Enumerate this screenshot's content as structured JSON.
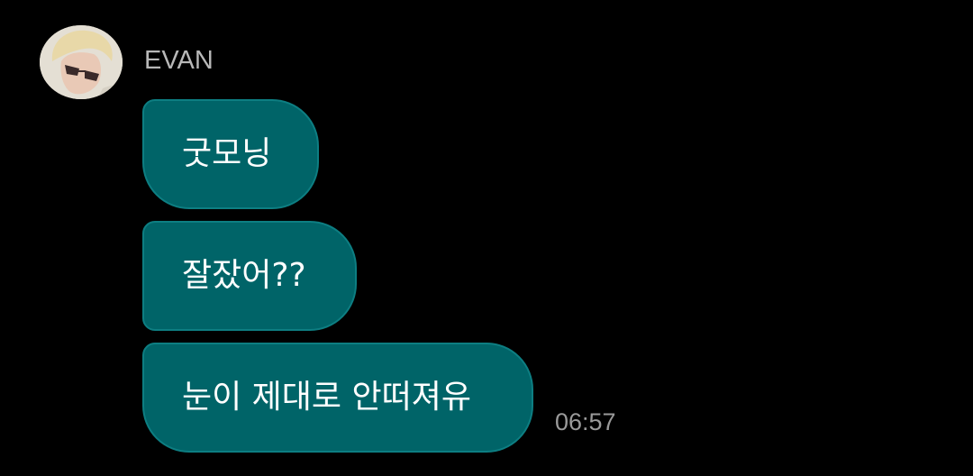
{
  "sender": {
    "name": "EVAN",
    "avatar_icon": "profile-photo-avatar"
  },
  "messages": [
    {
      "text": "굿모닝"
    },
    {
      "text": "잘잤어??"
    },
    {
      "text": "눈이 제대로 안떠져유"
    }
  ],
  "timestamp": "06:57",
  "colors": {
    "background": "#000000",
    "bubble": "#006468",
    "bubble_border": "#0d7e82",
    "bubble_text": "#ffffff",
    "sender_name": "#b8b8b8",
    "timestamp": "#9a9a9a"
  }
}
